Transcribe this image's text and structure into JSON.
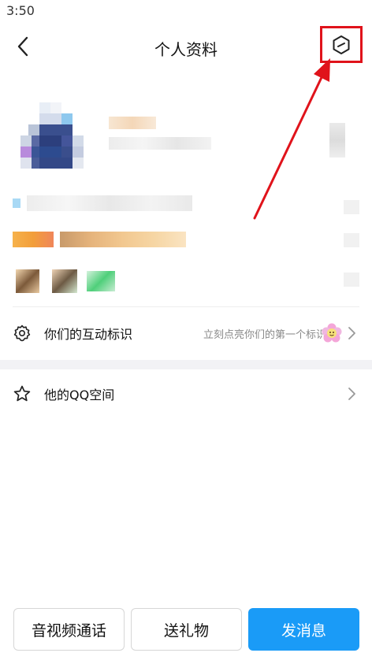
{
  "status_bar": {
    "time": "3:50"
  },
  "nav": {
    "title": "个人资料",
    "back_icon": "chevron-left-icon",
    "settings_icon": "hexagon-slash-icon"
  },
  "rows": {
    "interaction_label": "你们的互动标识",
    "interaction_hint": "立刻点亮你们的第一个标识",
    "qzone_label": "他的QQ空间"
  },
  "actions": {
    "call": "音视频通话",
    "gift": "送礼物",
    "message": "发消息"
  },
  "colors": {
    "primary": "#1a9bf7",
    "annotation_red": "#e0131b",
    "section_bg": "#f2f2f5"
  }
}
